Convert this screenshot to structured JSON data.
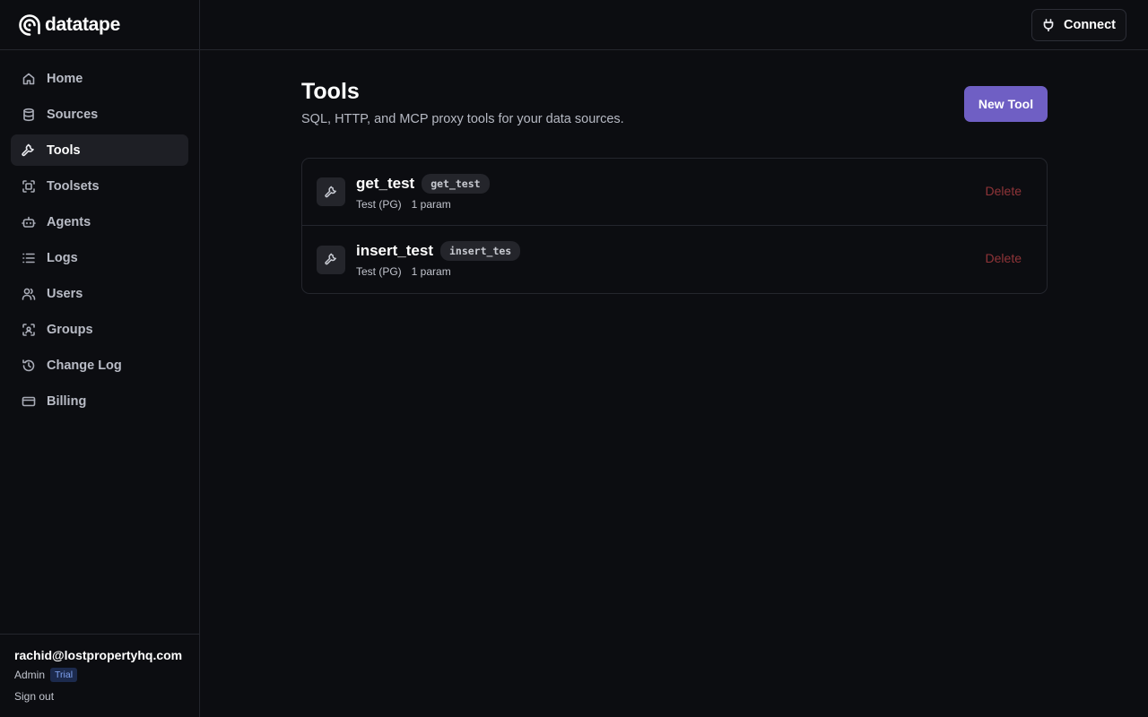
{
  "app": {
    "brand_name": "datatape"
  },
  "sidebar": {
    "items": [
      {
        "label": "Home",
        "icon": "home-icon",
        "active": false
      },
      {
        "label": "Sources",
        "icon": "database-icon",
        "active": false
      },
      {
        "label": "Tools",
        "icon": "wrench-icon",
        "active": true
      },
      {
        "label": "Toolsets",
        "icon": "scan-icon",
        "active": false
      },
      {
        "label": "Agents",
        "icon": "bot-icon",
        "active": false
      },
      {
        "label": "Logs",
        "icon": "list-icon",
        "active": false
      },
      {
        "label": "Users",
        "icon": "users-icon",
        "active": false
      },
      {
        "label": "Groups",
        "icon": "user-scan-icon",
        "active": false
      },
      {
        "label": "Change Log",
        "icon": "history-icon",
        "active": false
      },
      {
        "label": "Billing",
        "icon": "credit-card-icon",
        "active": false
      }
    ],
    "footer": {
      "email": "rachid@lostpropertyhq.com",
      "role": "Admin",
      "badge": "Trial",
      "sign_out": "Sign out"
    }
  },
  "topbar": {
    "connect_label": "Connect"
  },
  "main": {
    "title": "Tools",
    "subtitle": "SQL, HTTP, and MCP proxy tools for your data sources.",
    "new_tool_label": "New Tool",
    "tools": [
      {
        "name": "get_test",
        "slug": "get_test",
        "source": "Test (PG)",
        "params": "1 param",
        "delete_label": "Delete"
      },
      {
        "name": "insert_test",
        "slug": "insert_tes",
        "source": "Test (PG)",
        "params": "1 param",
        "delete_label": "Delete"
      }
    ]
  },
  "colors": {
    "background": "#0c0d11",
    "accent": "#6f5fc4",
    "danger": "#8f3438",
    "active_nav": "#1e1f25"
  }
}
